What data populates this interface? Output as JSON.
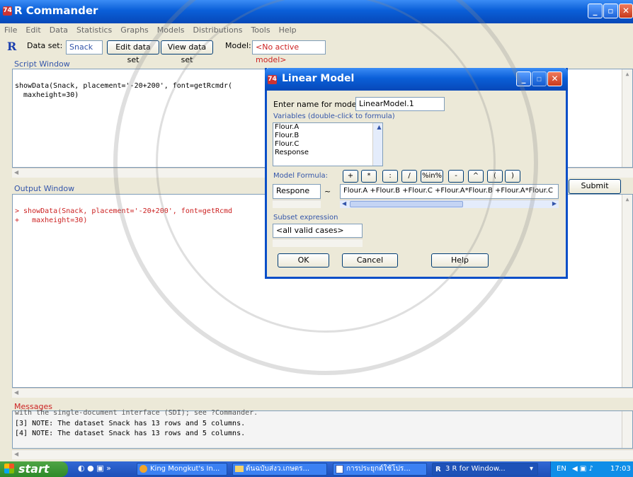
{
  "window": {
    "title": "R Commander"
  },
  "menu": [
    "File",
    "Edit",
    "Data",
    "Statistics",
    "Graphs",
    "Models",
    "Distributions",
    "Tools",
    "Help"
  ],
  "toolbar": {
    "dataset_label": "Data set:",
    "dataset_value": "Snack",
    "edit_label": "Edit data set",
    "view_label": "View data set",
    "model_label": "Model:",
    "model_value": "<No active model>"
  },
  "script": {
    "title": "Script Window",
    "lines": [
      "showData(Snack, placement='-20+200', font=getRcmdr(",
      "  maxheight=30)"
    ]
  },
  "submit_label": "Submit",
  "output": {
    "title": "Output Window",
    "lines": [
      "> showData(Snack, placement='-20+200', font=getRcmd",
      "+   maxheight=30)"
    ]
  },
  "messages": {
    "title": "Messages",
    "lines": [
      "with the single-document interface (SDI); see ?Commander.",
      "[3] NOTE: The dataset Snack has 13 rows and 5 columns.",
      "[4] NOTE: The dataset Snack has 13 rows and 5 columns."
    ]
  },
  "dialog": {
    "title": "Linear Model",
    "name_label": "Enter name for model:",
    "name_value": "LinearModel.1",
    "variables_label": "Variables (double-click to formula)",
    "variables": [
      "Flour.A",
      "Flour.B",
      "Flour.C",
      "Response"
    ],
    "formula_label": "Model Formula:",
    "operators": [
      "+",
      "*",
      ":",
      "/",
      "%in%",
      "-",
      "^",
      "(",
      ")"
    ],
    "lhs": "Respone",
    "tilde": "~",
    "rhs": "Flour.A +Flour.B +Flour.C +Flour.A*Flour.B +Flour.A*Flour.C",
    "subset_label": "Subset expression",
    "subset_value": "<all valid cases>",
    "ok_label": "OK",
    "cancel_label": "Cancel",
    "help_label": "Help"
  },
  "taskbar": {
    "start_label": "start",
    "items": [
      "King Mongkut's In...",
      "ต้นฉบับส่งว.เกษตร...",
      "การประยุกต์ใช้โปร...",
      "3 R for Window..."
    ],
    "lang": "EN",
    "clock": "17:03"
  }
}
